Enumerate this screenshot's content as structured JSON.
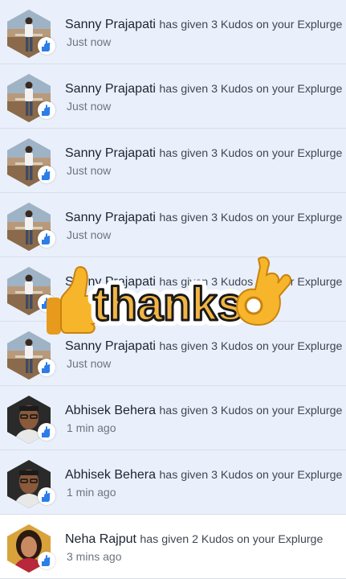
{
  "notifications": [
    {
      "name": "Sanny Prajapati",
      "message": "has given 3 Kudos on your Explurge",
      "time": "Just now",
      "avatar": "sanny",
      "unread": true
    },
    {
      "name": "Sanny Prajapati",
      "message": "has given 3 Kudos on your Explurge",
      "time": "Just now",
      "avatar": "sanny",
      "unread": true
    },
    {
      "name": "Sanny Prajapati",
      "message": "has given 3 Kudos on your Explurge",
      "time": "Just now",
      "avatar": "sanny",
      "unread": true
    },
    {
      "name": "Sanny Prajapati",
      "message": "has given 3 Kudos on your Explurge",
      "time": "Just now",
      "avatar": "sanny",
      "unread": true
    },
    {
      "name": "Sanny Prajapati",
      "message": "has given 3 Kudos on your Explurge",
      "time": "Just now",
      "avatar": "sanny",
      "unread": true
    },
    {
      "name": "Sanny Prajapati",
      "message": "has given 3 Kudos on your Explurge",
      "time": "Just now",
      "avatar": "sanny",
      "unread": true
    },
    {
      "name": "Abhisek Behera",
      "message": "has given 3 Kudos on your Explurge",
      "time": "1 min ago",
      "avatar": "abhisek",
      "unread": true
    },
    {
      "name": "Abhisek Behera",
      "message": "has given 3 Kudos on your Explurge",
      "time": "1 min ago",
      "avatar": "abhisek",
      "unread": true
    },
    {
      "name": "Neha Rajput",
      "message": "has given 2 Kudos on your Explurge",
      "time": "3 mins ago",
      "avatar": "neha",
      "unread": false
    }
  ],
  "badge_icon": "kudos-hand-icon",
  "sticker": {
    "text": "thanks",
    "icons": [
      "thumbs-up-icon",
      "ok-hand-icon"
    ]
  },
  "colors": {
    "unread_bg": "#e9f0fb",
    "read_bg": "#ffffff",
    "badge_blue": "#2b7de9",
    "sticker_text": "#f2b544"
  }
}
